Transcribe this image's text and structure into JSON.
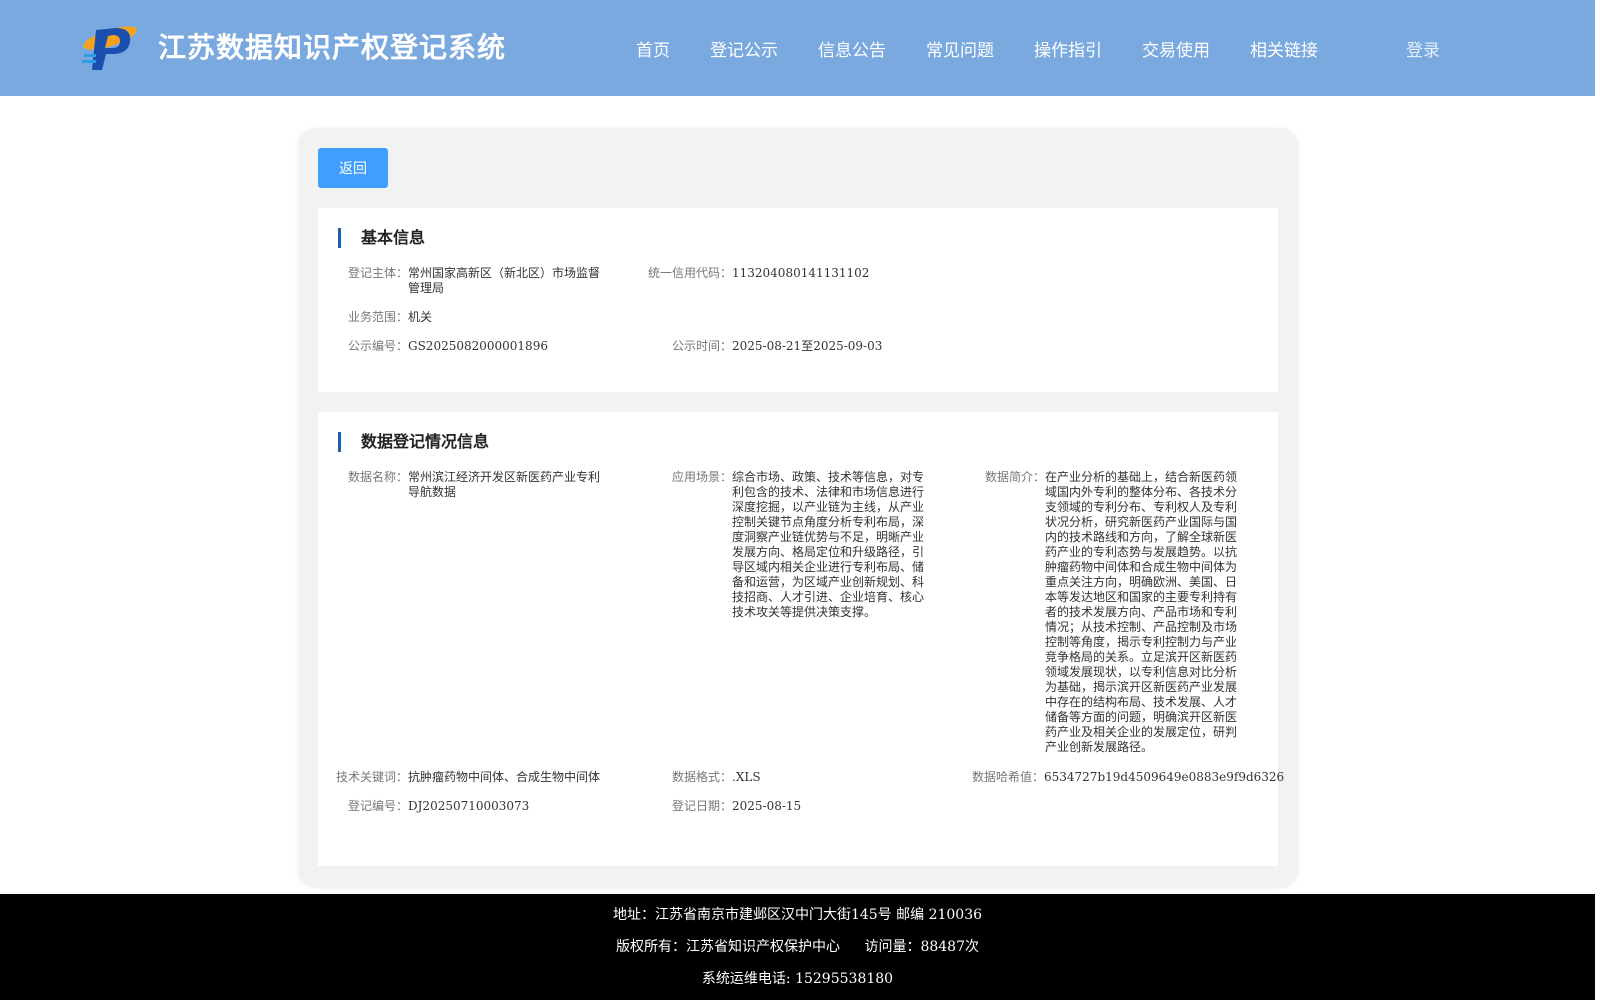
{
  "header": {
    "title": "江苏数据知识产权登记系统",
    "nav": [
      "首页",
      "登记公示",
      "信息公告",
      "常见问题",
      "操作指引",
      "交易使用",
      "相关链接"
    ],
    "login": "登录",
    "colors": {
      "header_bg": "#7aa9df",
      "accent": "#409eff",
      "title_bar": "#1e5fa8"
    }
  },
  "back_button": "返回",
  "basic": {
    "title": "基本信息",
    "subject_label": "登记主体：",
    "subject": "常州国家高新区（新北区）市场监督管理局",
    "credit_label": "统一信用代码：",
    "credit": "11320408014113110​2",
    "scope_label": "业务范围：",
    "scope": "机关",
    "notice_no_label": "公示编号：",
    "notice_no": "GS2025082000001896",
    "notice_time_label": "公示时间：",
    "notice_time": "2025-08-21至2025-09-03"
  },
  "registration": {
    "title": "数据登记情况信息",
    "name_label": "数据名称：",
    "name": "常州滨江经济开发区新医药产业专利导航数据",
    "scene_label": "应用场景：",
    "scene": "综合市场、政策、技术等信息，对专利包含的技术、法律和市场信息进行深度挖掘，以产业链为主线，从产业控制关键节点角度分析专利布局，深度洞察产业链优势与不足，明晰产业发展方向、格局定位和升级路径，引导区域内相关企业进行专利布局、储备和运营，为区域产业创新规划、科技招商、人才引进、企业培育、核心技术攻关等提供决策支撑。",
    "intro_label": "数据简介：",
    "intro": "在产业分析的基础上，结合新医药领域国内外专利的整体分布、各技术分支领域的专利分布、专利权人及专利状况分析，研究新医药产业国际与国内的技术路线和方向，了解全球新医药产业的专利态势与发展趋势。以抗肿瘤药物中间体和合成生物中间体为重点关注方向，明确欧洲、美国、日本等发达地区和国家的主要专利持有者的技术发展方向、产品市场和专利情况；从技术控制、产品控制及市场控制等角度，揭示专利控制力与产业竞争格局的关系。立足滨开区新医药领域发展现状，以专利信息对比分析为基础，揭示滨开区新医药产业发展中存在的结构布局、技术发展、人才储备等方面的问题，明确滨开区新医药产业及相关企业的发展定位，研判产业创新发展路径。",
    "keywords_label": "技术关键词：",
    "keywords": "抗肿瘤药物中间体、合成生物中间体",
    "format_label": "数据格式：",
    "format": ".XLS",
    "hash_label": "数据哈希值：",
    "hash": "6534727b19d4509649e0883e9f9d6326",
    "reg_no_label": "登记编号：",
    "reg_no": "DJ20250710003073",
    "reg_date_label": "登记日期：",
    "reg_date": "2025-08-15"
  },
  "footer": {
    "address": "地址：江苏省南京市建邺区汉中门大街145号 邮编 210036",
    "copyright": "版权所有：江苏省知识产权保护中心",
    "visits": "访问量：88487次",
    "phone": "系统运维电话: 15295538180"
  }
}
